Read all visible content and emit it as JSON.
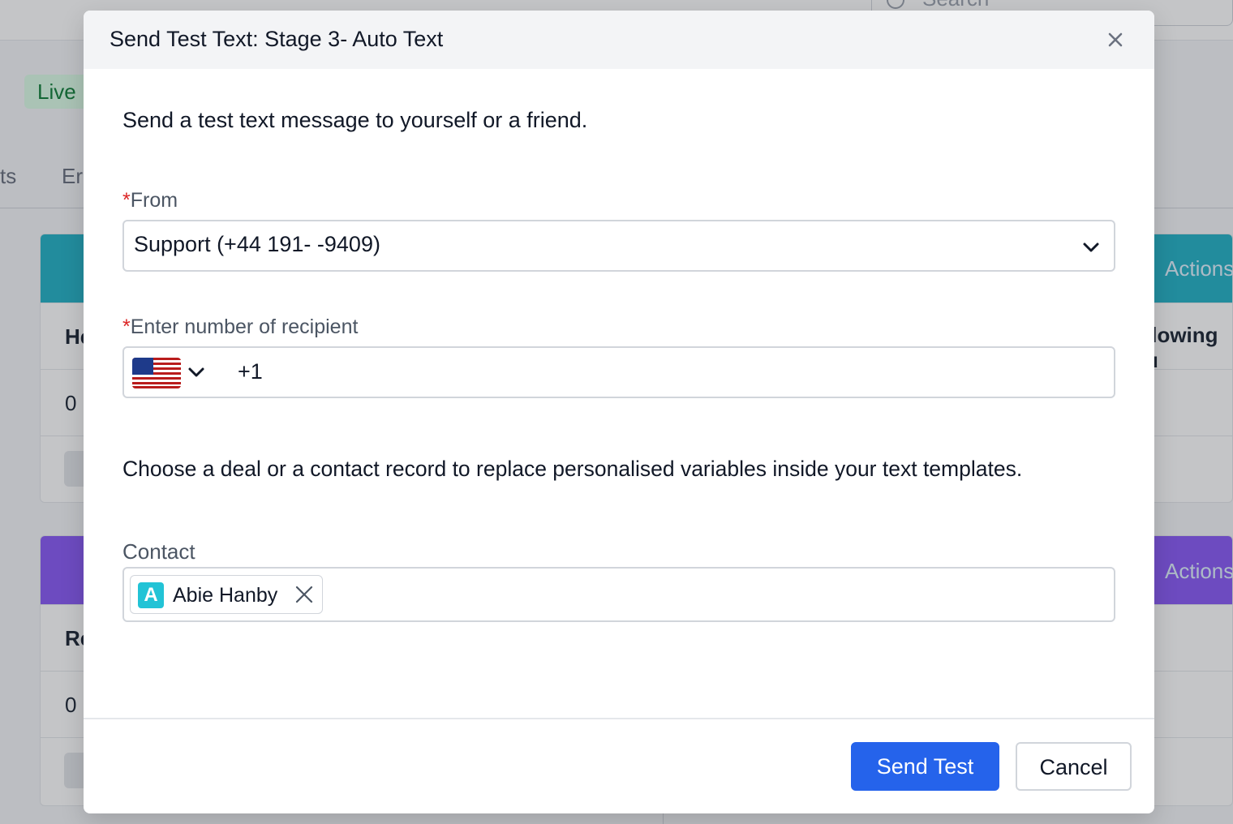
{
  "background": {
    "search_placeholder": "Search",
    "status_badge": "Live",
    "tabs": [
      "ts",
      "Er"
    ],
    "card1": {
      "rows": [
        "He",
        "0"
      ],
      "actions_label": "Actions",
      "right_text": "llowing u",
      "color": "#27b3c7"
    },
    "card2": {
      "rows": [
        "Re",
        "0"
      ],
      "actions_label": "Actions",
      "color": "#8b5cf6"
    }
  },
  "modal": {
    "title": "Send Test Text: Stage 3- Auto Text",
    "intro": "Send a test text message to yourself or a friend.",
    "from": {
      "required_mark": "*",
      "label": "From",
      "value": "Support (+44 191-  -9409)"
    },
    "recipient": {
      "required_mark": "*",
      "label": "Enter number of recipient",
      "country_flag": "us-flag-icon",
      "prefix": "+1"
    },
    "hint": "Choose a deal or a contact record to replace personalised variables inside your text templates.",
    "contact": {
      "label": "Contact",
      "chip_initial": "A",
      "chip_name": "Abie Hanby"
    },
    "buttons": {
      "send": "Send Test",
      "cancel": "Cancel"
    }
  },
  "colors": {
    "primary": "#2563eb",
    "required": "#dc2626",
    "avatar": "#22c3d6"
  }
}
